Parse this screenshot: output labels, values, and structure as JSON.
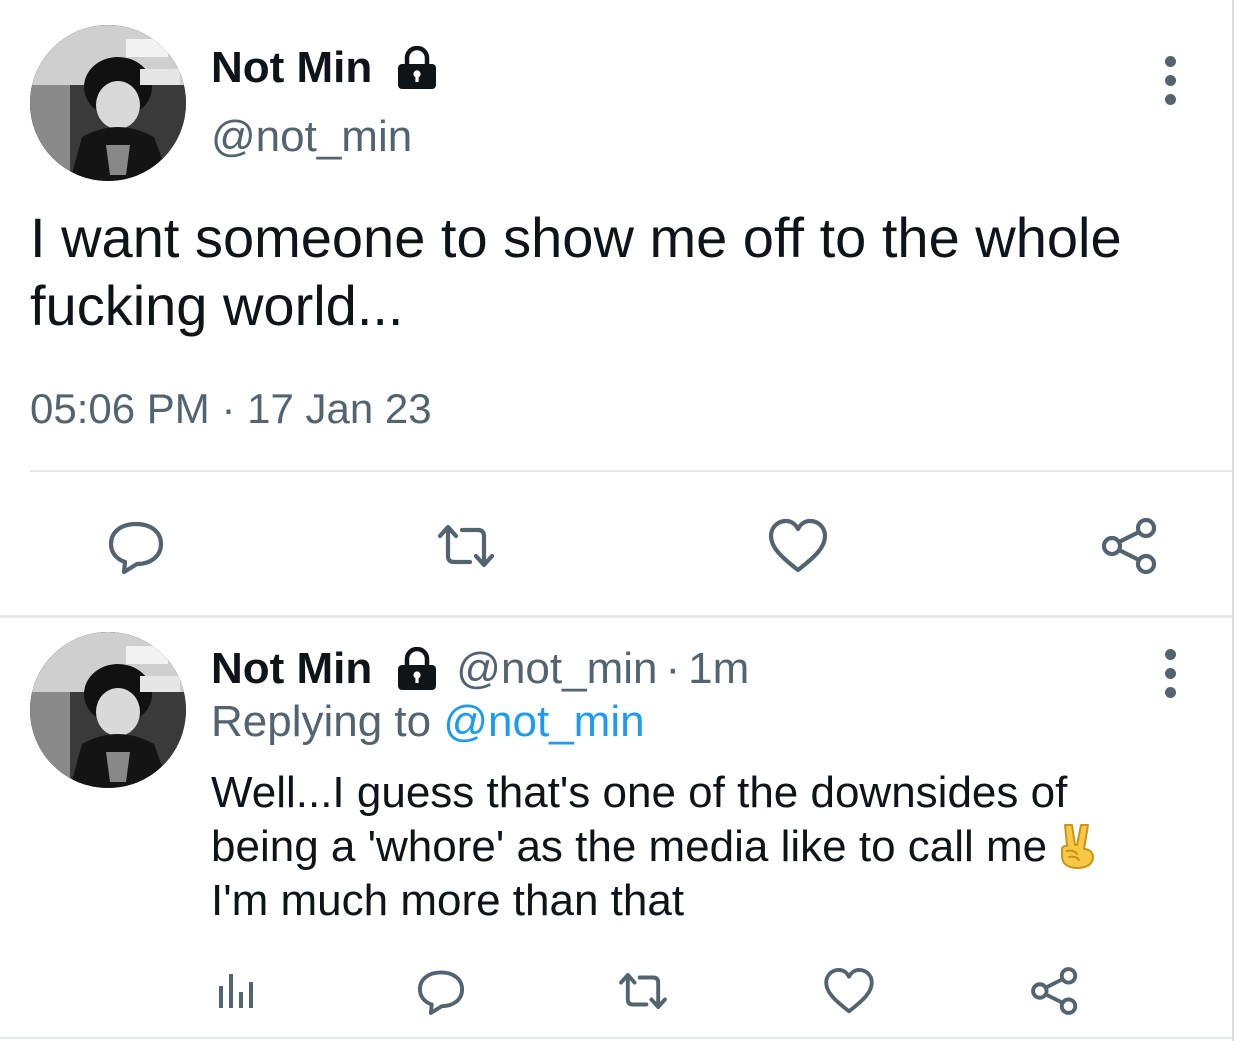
{
  "main_tweet": {
    "display_name": "Not Min",
    "handle": "@not_min",
    "text": "I want someone to show me off to the whole fucking world...",
    "time": "05:06 PM",
    "separator": "·",
    "date": "17 Jan 23",
    "icons": {
      "lock": "lock-icon",
      "more": "more-vertical-icon",
      "reply": "reply-icon",
      "retweet": "retweet-icon",
      "like": "heart-icon",
      "share": "share-icon"
    }
  },
  "reply_tweet": {
    "display_name": "Not Min",
    "handle": "@not_min",
    "separator": "·",
    "time_ago": "1m",
    "replying_prefix": "Replying to",
    "replying_to": "@not_min",
    "text_line1": "Well...I guess that's one of the downsides of",
    "text_line2": "being a 'whore' as the media like to call me",
    "text_line3": "I'm much more than that",
    "emoji": "victory-hand-emoji",
    "icons": {
      "analytics": "analytics-icon",
      "reply": "reply-icon",
      "retweet": "retweet-icon",
      "like": "heart-icon",
      "share": "share-icon"
    }
  },
  "colors": {
    "text_primary": "#0f1419",
    "text_secondary": "#536471",
    "link": "#1d9bf0",
    "divider": "#e4e8eb"
  }
}
